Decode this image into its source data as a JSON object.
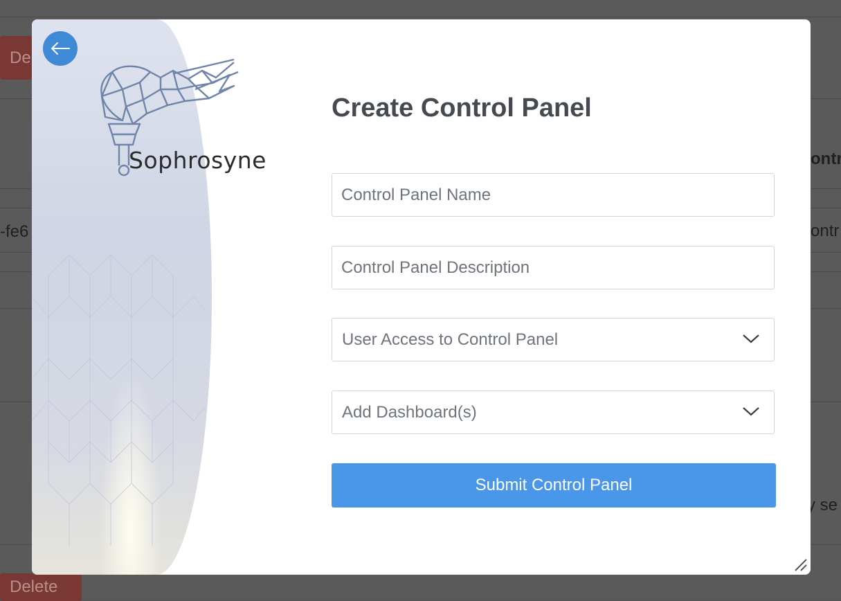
{
  "background": {
    "delete_label_top": "De",
    "delete_label_bottom": "Delete",
    "fragment_left": "-fe6",
    "fragment_right_1": "ontr",
    "fragment_right_2": "ontr",
    "fragment_right_3": "y se"
  },
  "modal": {
    "back_icon": "arrow-left-icon",
    "logo_text": "Sophrosyne",
    "title": "Create Control Panel",
    "fields": {
      "name_placeholder": "Control Panel Name",
      "description_placeholder": "Control Panel Description",
      "user_access_label": "User Access to Control Panel",
      "dashboards_label": "Add Dashboard(s)"
    },
    "submit_label": "Submit Control Panel",
    "resize_icon": "resize-handle-icon"
  },
  "colors": {
    "accent": "#4a97ea",
    "back_button": "#3f8ad6",
    "title": "#454a50",
    "placeholder": "#6d747b",
    "delete_button": "#7a3834"
  }
}
